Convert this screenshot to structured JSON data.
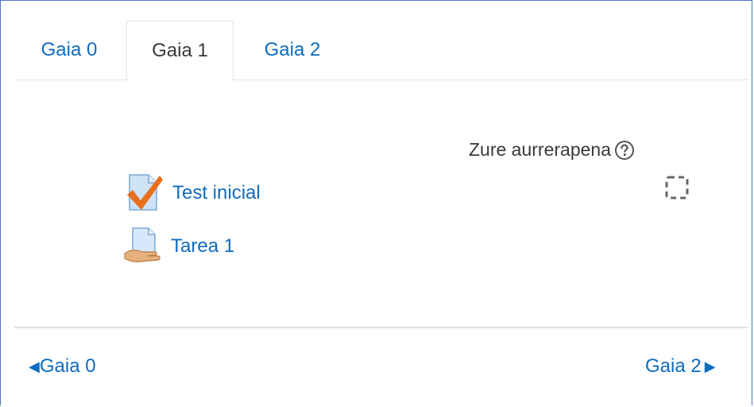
{
  "tabs": [
    {
      "label": "Gaia 0"
    },
    {
      "label": "Gaia 1"
    },
    {
      "label": "Gaia 2"
    }
  ],
  "section": {
    "progress_label": "Zure aurrerapena",
    "activities": [
      {
        "label": "Test inicial",
        "icon": "quiz-checkmark-icon"
      },
      {
        "label": "Tarea 1",
        "icon": "assignment-hand-icon"
      }
    ]
  },
  "navigation": {
    "prev_label": "Gaia 0",
    "next_label": "Gaia 2"
  },
  "colors": {
    "link": "#0f6cbf",
    "text": "#373a3c",
    "border": "#dee2e6",
    "check": "#e86f1e"
  }
}
